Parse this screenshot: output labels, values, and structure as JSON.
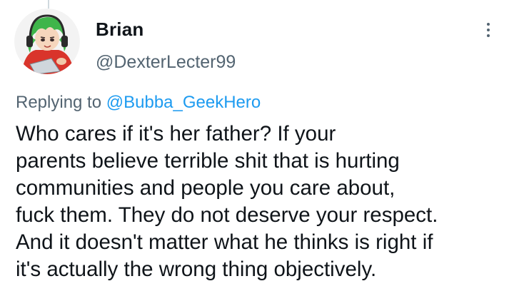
{
  "author": {
    "name": "Brian",
    "handle": "@DexterLecter99",
    "avatar_icon": "anime-character-avatar"
  },
  "more_menu": {
    "icon": "more-vertical-icon"
  },
  "reply": {
    "prefix": "Replying to",
    "handle": "@Bubba_GeekHero"
  },
  "tweet": {
    "lines": [
      "Who cares if it's her father? If your",
      "parents believe terrible shit that is hurting",
      "communities and people you care about,",
      "fuck them. They do not deserve your respect.",
      "And it doesn't matter what he thinks is right if",
      "it's actually the wrong thing objectively."
    ]
  },
  "colors": {
    "text": "#0f1419",
    "secondary": "#536471",
    "link": "#1d9bf0",
    "thread_line": "#cfd9de"
  }
}
